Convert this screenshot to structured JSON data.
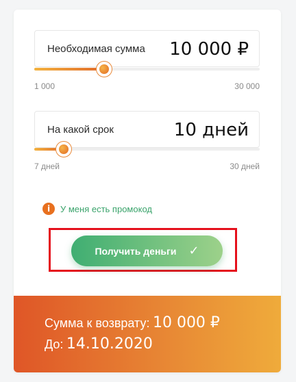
{
  "amount": {
    "label": "Необходимая сумма",
    "value": "10 000 ₽",
    "min_label": "1 000",
    "max_label": "30 000",
    "slider_fraction": 0.31
  },
  "term": {
    "label": "На какой срок",
    "value": "10 дней",
    "min_label": "7 дней",
    "max_label": "30 дней",
    "slider_fraction": 0.13
  },
  "promo": {
    "icon": "info-icon",
    "icon_glyph": "i",
    "text": "У меня есть промокод"
  },
  "cta": {
    "label": "Получить деньги",
    "icon": "check-icon",
    "icon_glyph": "✓"
  },
  "summary": {
    "return_label": "Сумма к возврату:",
    "return_value": "10 000 ₽",
    "due_label": "До:",
    "due_value": "14.10.2020"
  },
  "colors": {
    "accent_orange": "#e26a24",
    "accent_green": "#3fae72",
    "highlight_red": "#e5101c"
  }
}
